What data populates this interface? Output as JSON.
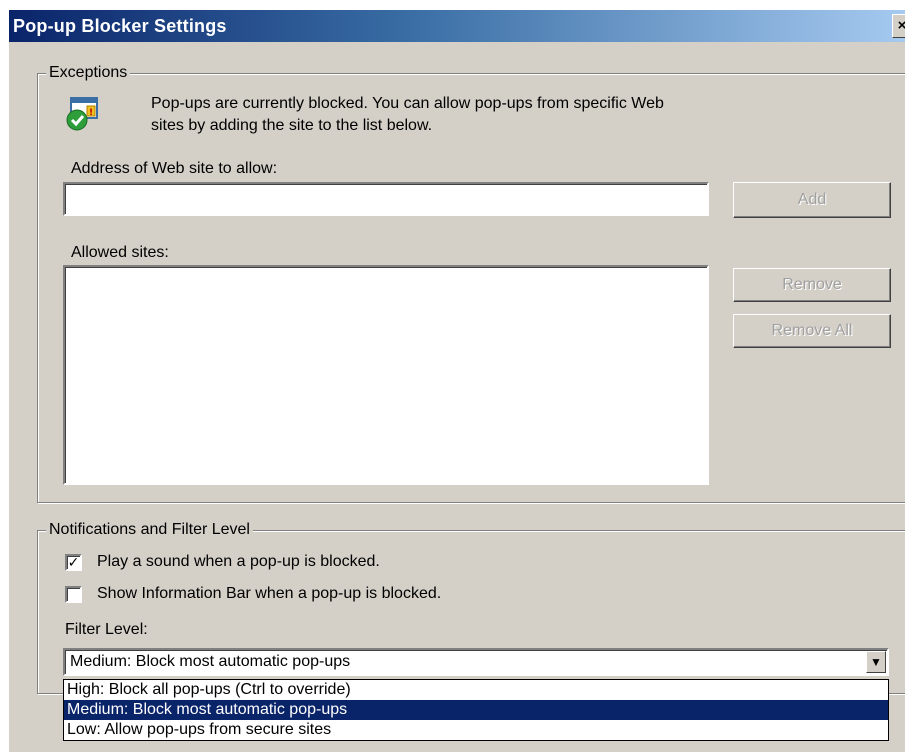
{
  "window": {
    "title": "Pop-up Blocker Settings"
  },
  "exceptions": {
    "group_label": "Exceptions",
    "info_line1": "Pop-ups are currently blocked.  You can allow pop-ups from specific Web",
    "info_line2": "sites by adding the site to the list below.",
    "address_label": "Address of Web site to allow:",
    "address_value": "",
    "add_button": "Add",
    "allowed_label": "Allowed sites:",
    "allowed_sites": [],
    "remove_button": "Remove",
    "remove_all_button": "Remove All"
  },
  "notifications": {
    "group_label": "Notifications and Filter Level",
    "play_sound_label": "Play a sound when a pop-up is blocked.",
    "play_sound_checked": true,
    "show_infobar_label": "Show Information Bar when a pop-up is blocked.",
    "show_infobar_checked": false,
    "filter_level_label": "Filter Level:",
    "filter_selected": "Medium: Block most automatic pop-ups",
    "filter_options": [
      "High: Block all pop-ups (Ctrl to override)",
      "Medium: Block most automatic pop-ups",
      "Low: Allow pop-ups from secure sites"
    ]
  },
  "icons": {
    "info_icon": "popup-shield-icon",
    "close": "close-icon",
    "dropdown": "chevron-down-icon",
    "check": "checkmark-icon"
  },
  "colors": {
    "titlebar_start": "#0a246a",
    "titlebar_end": "#a6caf0",
    "dialog_bg": "#d4d0c8",
    "selection": "#0a246a"
  }
}
